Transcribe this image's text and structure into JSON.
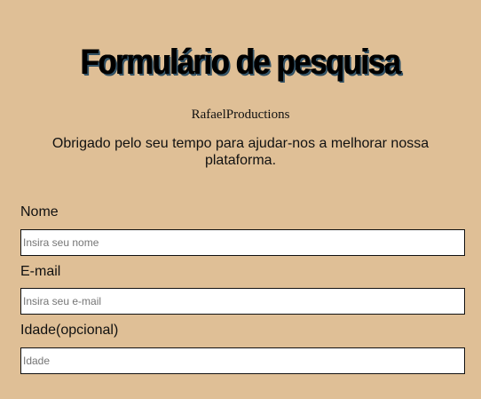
{
  "header": {
    "title": "Formulário de pesquisa",
    "author": "RafaelProductions",
    "description": "Obrigado pelo seu tempo para ajudar-nos a melhorar nossa plataforma."
  },
  "form": {
    "name": {
      "label": "Nome",
      "placeholder": "Insira seu nome",
      "value": ""
    },
    "email": {
      "label": "E-mail",
      "placeholder": "Insira seu e-mail",
      "value": ""
    },
    "age": {
      "label": "Idade(opcional)",
      "placeholder": "Idade",
      "value": ""
    }
  },
  "colors": {
    "background": "#dfbf96",
    "input_background": "#ffffff",
    "input_border": "#111111"
  }
}
